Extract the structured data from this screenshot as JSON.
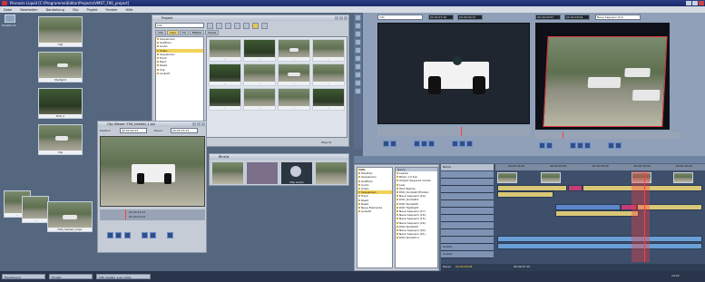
{
  "window": {
    "title": "Pinnacle Liquid [C:\\Programme\\Editor\\Projects\\VMST_F06_project]"
  },
  "menu": [
    "Datei",
    "Bearbeiten",
    "Darstellung",
    "Clip",
    "Projekt",
    "Fenster",
    "Hilfe"
  ],
  "desktop_icon": {
    "label": "Projekt.mk"
  },
  "left_thumbs": [
    {
      "caption": "Clip"
    },
    {
      "caption": "Startgrid"
    },
    {
      "caption": "Exit_2"
    },
    {
      "caption": "Clip"
    }
  ],
  "stack_thumbs": [
    {
      "caption": "..."
    },
    {
      "caption": "..."
    },
    {
      "caption": "F06_Heidekl_Clip1"
    }
  ],
  "project_panel": {
    "title": "Projekt",
    "bin_field": "Info",
    "tabs": [
      "Info",
      "Clips",
      "FX",
      "Effekte",
      "Media"
    ],
    "tree": [
      "Sequenzen",
      "Grafiken",
      "Audio",
      "Video",
      "Sequenzen",
      "Track",
      "Paint",
      "Raw2",
      "Clip",
      "rec&dit"
    ],
    "thumb_labels": [
      "..",
      "..",
      "..",
      "..",
      "..",
      "..",
      "..",
      "..",
      "..",
      "..",
      "..",
      ".."
    ],
    "status": "Objects"
  },
  "clipviewer": {
    "title": "Clip Viewer: F06_heidekl_1.avi",
    "pos_label": "Position",
    "pos_value": "00:00:26:23",
    "dur_label": "Dauer",
    "dur_value": "00:00:15:15",
    "tc_left": "00:00:16:15",
    "tc_right": "00:00:30:22"
  },
  "sound_panel": {
    "title": "Bins\\Is",
    "label": "Clip Audio"
  },
  "source_monitor": {
    "field": "info",
    "tc1": "00:00:27:10",
    "tc2": "00:00:00:17"
  },
  "record_monitor": {
    "tc1": "00:00:00:57",
    "tc2": "00:00:26:09",
    "field": "Neue Sequenz (12)"
  },
  "bin_browser": {
    "header": "Info",
    "tree": [
      "Desktop",
      "Sequenzen",
      "Grafiken",
      "Audio",
      "Video",
      "Sequenzen",
      "Track",
      "Raw2",
      "Raw2",
      "Neue Elemente",
      "rec&dit"
    ],
    "list_header": "Name",
    "list": [
      "Leader",
      "Black 1.0 top",
      "Output Sequenz media",
      "Leer",
      "Text Tagline",
      "DVD_Kontaktl Pfosten",
      "Neue Sequenz (19)",
      "DVD_Kontakt1",
      "DVD Kontakt2",
      "DVD Highlight",
      "Neue Sequenz (17)",
      "Neue Sequenz (18)",
      "Neue Sequenz (15)",
      "Neue Sequenz (16)",
      "DVD Kontakt3",
      "Neue Sequenz (20)",
      "Neue Sequenz (21)",
      "DVD Kontakt 2"
    ]
  },
  "timeline": {
    "name_header": "Name",
    "tracks": [
      "",
      "",
      "",
      "",
      "",
      "",
      "",
      "",
      "",
      "",
      "Audio1",
      "Audio2"
    ],
    "timecode_label": "Dauer",
    "timecode": "00:00:26:08",
    "ruler": [
      "00:00:24:00",
      "00:00:26:00",
      "00:00:28:00",
      "00:00:30:00",
      "00:00:32:00"
    ],
    "status_tc": "00:00:27:10"
  },
  "taskbar": {
    "items": [
      "Hauptmenü",
      "Projekt",
      "F06_heidekl_1.avi_Clips"
    ],
    "clock": "19:52"
  }
}
